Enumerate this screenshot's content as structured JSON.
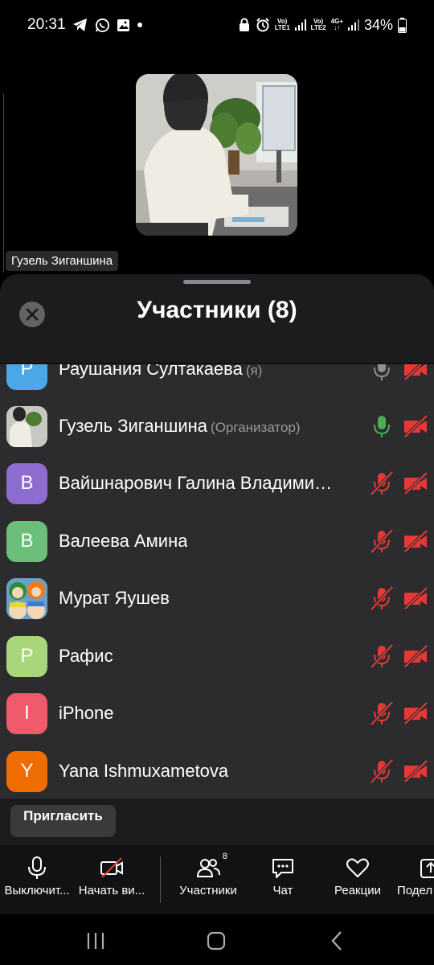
{
  "status": {
    "time": "20:31",
    "battery": "34%",
    "sim1": "LTE1",
    "sim2": "LTE2",
    "net": "4G+"
  },
  "video": {
    "speaker_name": "Гузель Зиганшина"
  },
  "sheet": {
    "title": "Участники (8)"
  },
  "participants": [
    {
      "initial": "Р",
      "name": "Раушания Султакаева",
      "role": "(я)",
      "avatar_color": "#4aa8e8",
      "mic": "gray",
      "cam": "off"
    },
    {
      "initial": "",
      "name": "Гузель Зиганшина",
      "role": "(Организатор)",
      "avatar_color": "#6b6b6b",
      "avatar_photo": "woman-at-desk",
      "mic": "green",
      "cam": "off"
    },
    {
      "initial": "В",
      "name": "Вайшнарович Галина Владимировна",
      "role": "",
      "avatar_color": "#8d6cd0",
      "mic": "muted",
      "cam": "off"
    },
    {
      "initial": "В",
      "name": "Валеева Амина",
      "role": "",
      "avatar_color": "#6cbf7a",
      "mic": "muted",
      "cam": "off"
    },
    {
      "initial": "",
      "name": "Мурат Яушев",
      "role": "",
      "avatar_color": "#d8e7ef",
      "avatar_photo": "cartoon-characters",
      "mic": "muted",
      "cam": "off"
    },
    {
      "initial": "Р",
      "name": "Рафис",
      "role": "",
      "avatar_color": "#a9d57c",
      "mic": "muted",
      "cam": "off"
    },
    {
      "initial": "I",
      "name": "iPhone",
      "role": "",
      "avatar_color": "#f05a6a",
      "mic": "muted",
      "cam": "off"
    },
    {
      "initial": "Y",
      "name": "Yana Ishmuxametova",
      "role": "",
      "avatar_color": "#ef6c00",
      "mic": "muted",
      "cam": "off"
    }
  ],
  "invite": {
    "label": "Пригласить"
  },
  "toolbar": {
    "mute_label": "Выключит...",
    "video_label": "Начать ви...",
    "participants_label": "Участники",
    "participants_count": "8",
    "chat_label": "Чат",
    "reactions_label": "Реакции",
    "share_label": "Подел"
  },
  "colors": {
    "muted_red": "#e53935",
    "active_green": "#4caf50",
    "sheet_bg": "#1c1c1e",
    "list_bg": "#2c2c2e"
  }
}
